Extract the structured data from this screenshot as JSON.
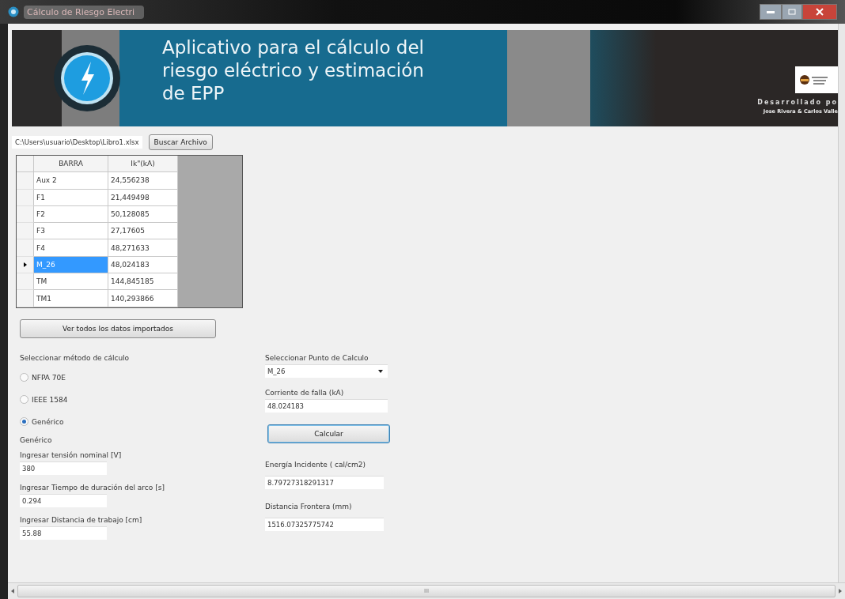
{
  "window": {
    "title": "Cálculo de Riesgo Electri"
  },
  "banner": {
    "title": "Aplicativo para el cálculo del riesgo eléctrico y estimación de EPP",
    "credit_label": "Desarrollado po",
    "credit_names": "Jose Rivera & Carlos Valle"
  },
  "file": {
    "path": "C:\\Users\\usuario\\Desktop\\Libro1.xlsx",
    "button": "Buscar Archivo"
  },
  "table": {
    "columns": [
      "BARRA",
      "Ik\"(kA)"
    ],
    "rows": [
      {
        "cells": [
          "Aux 2",
          "24,556238"
        ],
        "selected": false
      },
      {
        "cells": [
          "F1",
          "21,449498"
        ],
        "selected": false
      },
      {
        "cells": [
          "F2",
          "50,128085"
        ],
        "selected": false
      },
      {
        "cells": [
          "F3",
          "27,17605"
        ],
        "selected": false
      },
      {
        "cells": [
          "F4",
          "48,271633"
        ],
        "selected": false
      },
      {
        "cells": [
          "M_26",
          "48,024183"
        ],
        "selected": true
      },
      {
        "cells": [
          "TM",
          "144,845185"
        ],
        "selected": false
      },
      {
        "cells": [
          "TM1",
          "140,293866"
        ],
        "selected": false
      }
    ]
  },
  "view_all_button": "Ver todos los datos importados",
  "method": {
    "label": "Seleccionar método de cálculo",
    "options": [
      {
        "label": "NFPA 70E",
        "selected": false
      },
      {
        "label": "IEEE 1584",
        "selected": false
      },
      {
        "label": "Genérico",
        "selected": true
      }
    ]
  },
  "generic": {
    "heading": "Genérico",
    "fields": [
      {
        "label": "Ingresar tensión nominal [V]",
        "value": "380"
      },
      {
        "label": "Ingresar Tiempo de duración del arco [s]",
        "value": "0.294"
      },
      {
        "label": "Ingresar Distancia de trabajo [cm]",
        "value": "55.88"
      }
    ]
  },
  "point": {
    "label": "Seleccionar Punto de Calculo",
    "value": "M_26"
  },
  "fault_current": {
    "label": "Corriente de falla (kA)",
    "value": "48.024183"
  },
  "calculate_button": "Calcular",
  "results": [
    {
      "label": "Energía Incidente ( cal/cm2)",
      "value": "8.79727318291317"
    },
    {
      "label": "Distancia Frontera (mm)",
      "value": "1516.07325775742"
    }
  ],
  "scrollbar": {
    "thumb_label": "III"
  }
}
